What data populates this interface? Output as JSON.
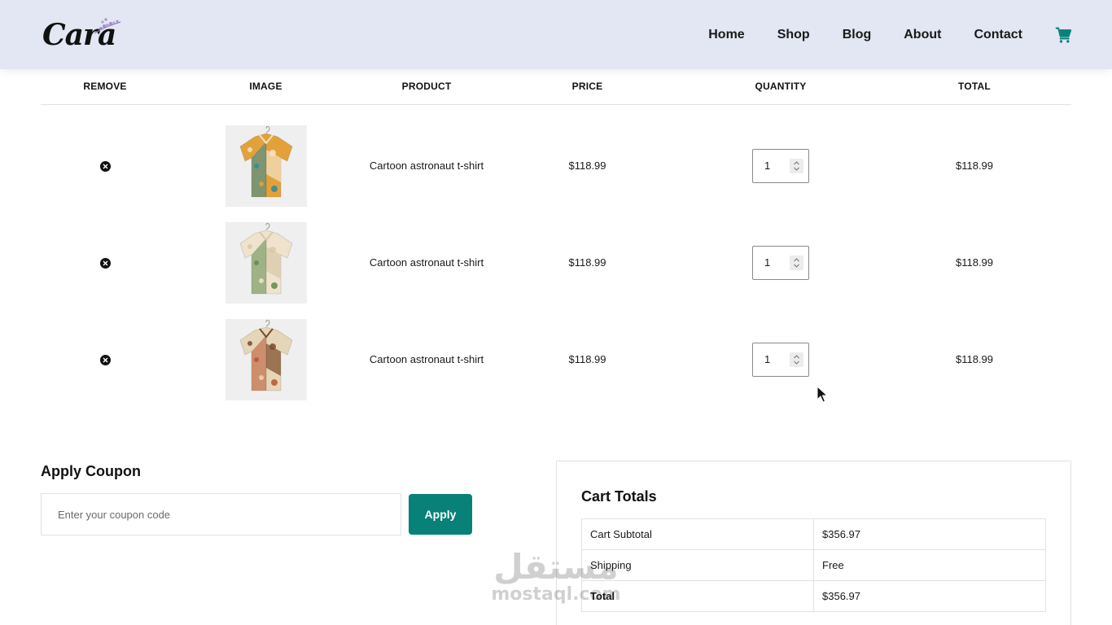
{
  "brand": {
    "name": "Cara"
  },
  "nav": {
    "items": [
      {
        "label": "Home"
      },
      {
        "label": "Shop"
      },
      {
        "label": "Blog"
      },
      {
        "label": "About"
      },
      {
        "label": "Contact"
      }
    ],
    "cart_icon": "shopping-cart-icon"
  },
  "cart": {
    "headers": {
      "remove": "REMOVE",
      "image": "IMAGE",
      "product": "PRODUCT",
      "price": "PRICE",
      "quantity": "QUANTITY",
      "total": "TOTAL"
    },
    "rows": [
      {
        "product": "Cartoon astronaut t-shirt",
        "price": "$118.99",
        "quantity": "1",
        "total": "$118.99",
        "shirt_colors": [
          "#e3a13a",
          "#2e8a9c",
          "#f2e4c8"
        ]
      },
      {
        "product": "Cartoon astronaut t-shirt",
        "price": "$118.99",
        "quantity": "1",
        "total": "$118.99",
        "shirt_colors": [
          "#efe3cd",
          "#5c8a4c",
          "#d9c8a8"
        ]
      },
      {
        "product": "Cartoon astronaut t-shirt",
        "price": "$118.99",
        "quantity": "1",
        "total": "$118.99",
        "shirt_colors": [
          "#e6d6b8",
          "#b8542f",
          "#7a4a2a"
        ]
      }
    ]
  },
  "coupon": {
    "title": "Apply Coupon",
    "placeholder": "Enter your coupon code",
    "button": "Apply"
  },
  "totals": {
    "title": "Cart Totals",
    "rows": [
      {
        "label": "Cart Subtotal",
        "value": "$356.97"
      },
      {
        "label": "Shipping",
        "value": "Free"
      },
      {
        "label": "Total",
        "value": "$356.97"
      }
    ]
  },
  "watermark": {
    "arabic": "مستقل",
    "latin": "mostaql.com"
  },
  "colors": {
    "header_bg": "#e3e6f3",
    "accent": "#088178"
  }
}
